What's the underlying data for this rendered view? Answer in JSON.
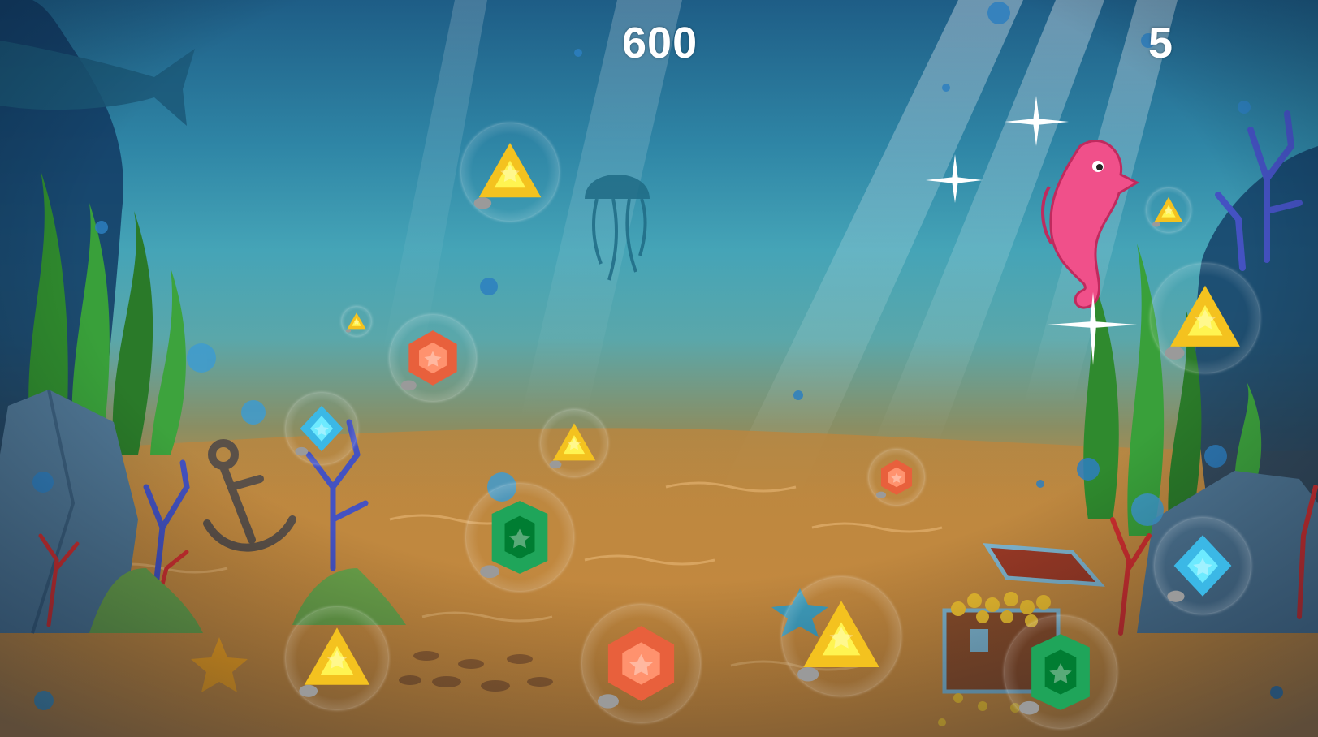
{
  "hud": {
    "score": "600",
    "lives": "5"
  },
  "colors": {
    "water_top": "#1e5d86",
    "water_mid": "#45a4b7",
    "sand": "#c98a3e",
    "gem_yellow": "#f4c21f",
    "gem_orange": "#e8603c",
    "gem_green": "#1fa55a",
    "gem_blue": "#3bb8e6",
    "seahorse": "#f0508a"
  },
  "gem_bubbles": [
    {
      "gem": "yellow-triangle-gem-icon",
      "kind": "triangle",
      "color": "#f4c21f"
    },
    {
      "gem": "yellow-triangle-gem-icon",
      "kind": "triangle",
      "color": "#f4c21f"
    },
    {
      "gem": "orange-hexagon-gem-icon",
      "kind": "hexagon",
      "color": "#e8603c"
    },
    {
      "gem": "blue-diamond-gem-icon",
      "kind": "diamond",
      "color": "#3bb8e6"
    },
    {
      "gem": "yellow-triangle-gem-icon",
      "kind": "triangle",
      "color": "#f4c21f"
    },
    {
      "gem": "green-emerald-gem-icon",
      "kind": "emerald",
      "color": "#1fa55a"
    },
    {
      "gem": "yellow-triangle-gem-icon",
      "kind": "triangle",
      "color": "#f4c21f"
    },
    {
      "gem": "orange-hexagon-gem-icon",
      "kind": "hexagon",
      "color": "#e8603c"
    },
    {
      "gem": "yellow-triangle-gem-icon",
      "kind": "triangle",
      "color": "#f4c21f"
    },
    {
      "gem": "orange-hexagon-gem-icon",
      "kind": "hexagon",
      "color": "#e8603c"
    },
    {
      "gem": "green-emerald-gem-icon",
      "kind": "emerald",
      "color": "#1fa55a"
    },
    {
      "gem": "yellow-triangle-gem-icon",
      "kind": "triangle",
      "color": "#f4c21f"
    },
    {
      "gem": "yellow-triangle-gem-icon",
      "kind": "triangle",
      "color": "#f4c21f"
    },
    {
      "gem": "blue-diamond-gem-icon",
      "kind": "diamond",
      "color": "#3bb8e6"
    }
  ]
}
